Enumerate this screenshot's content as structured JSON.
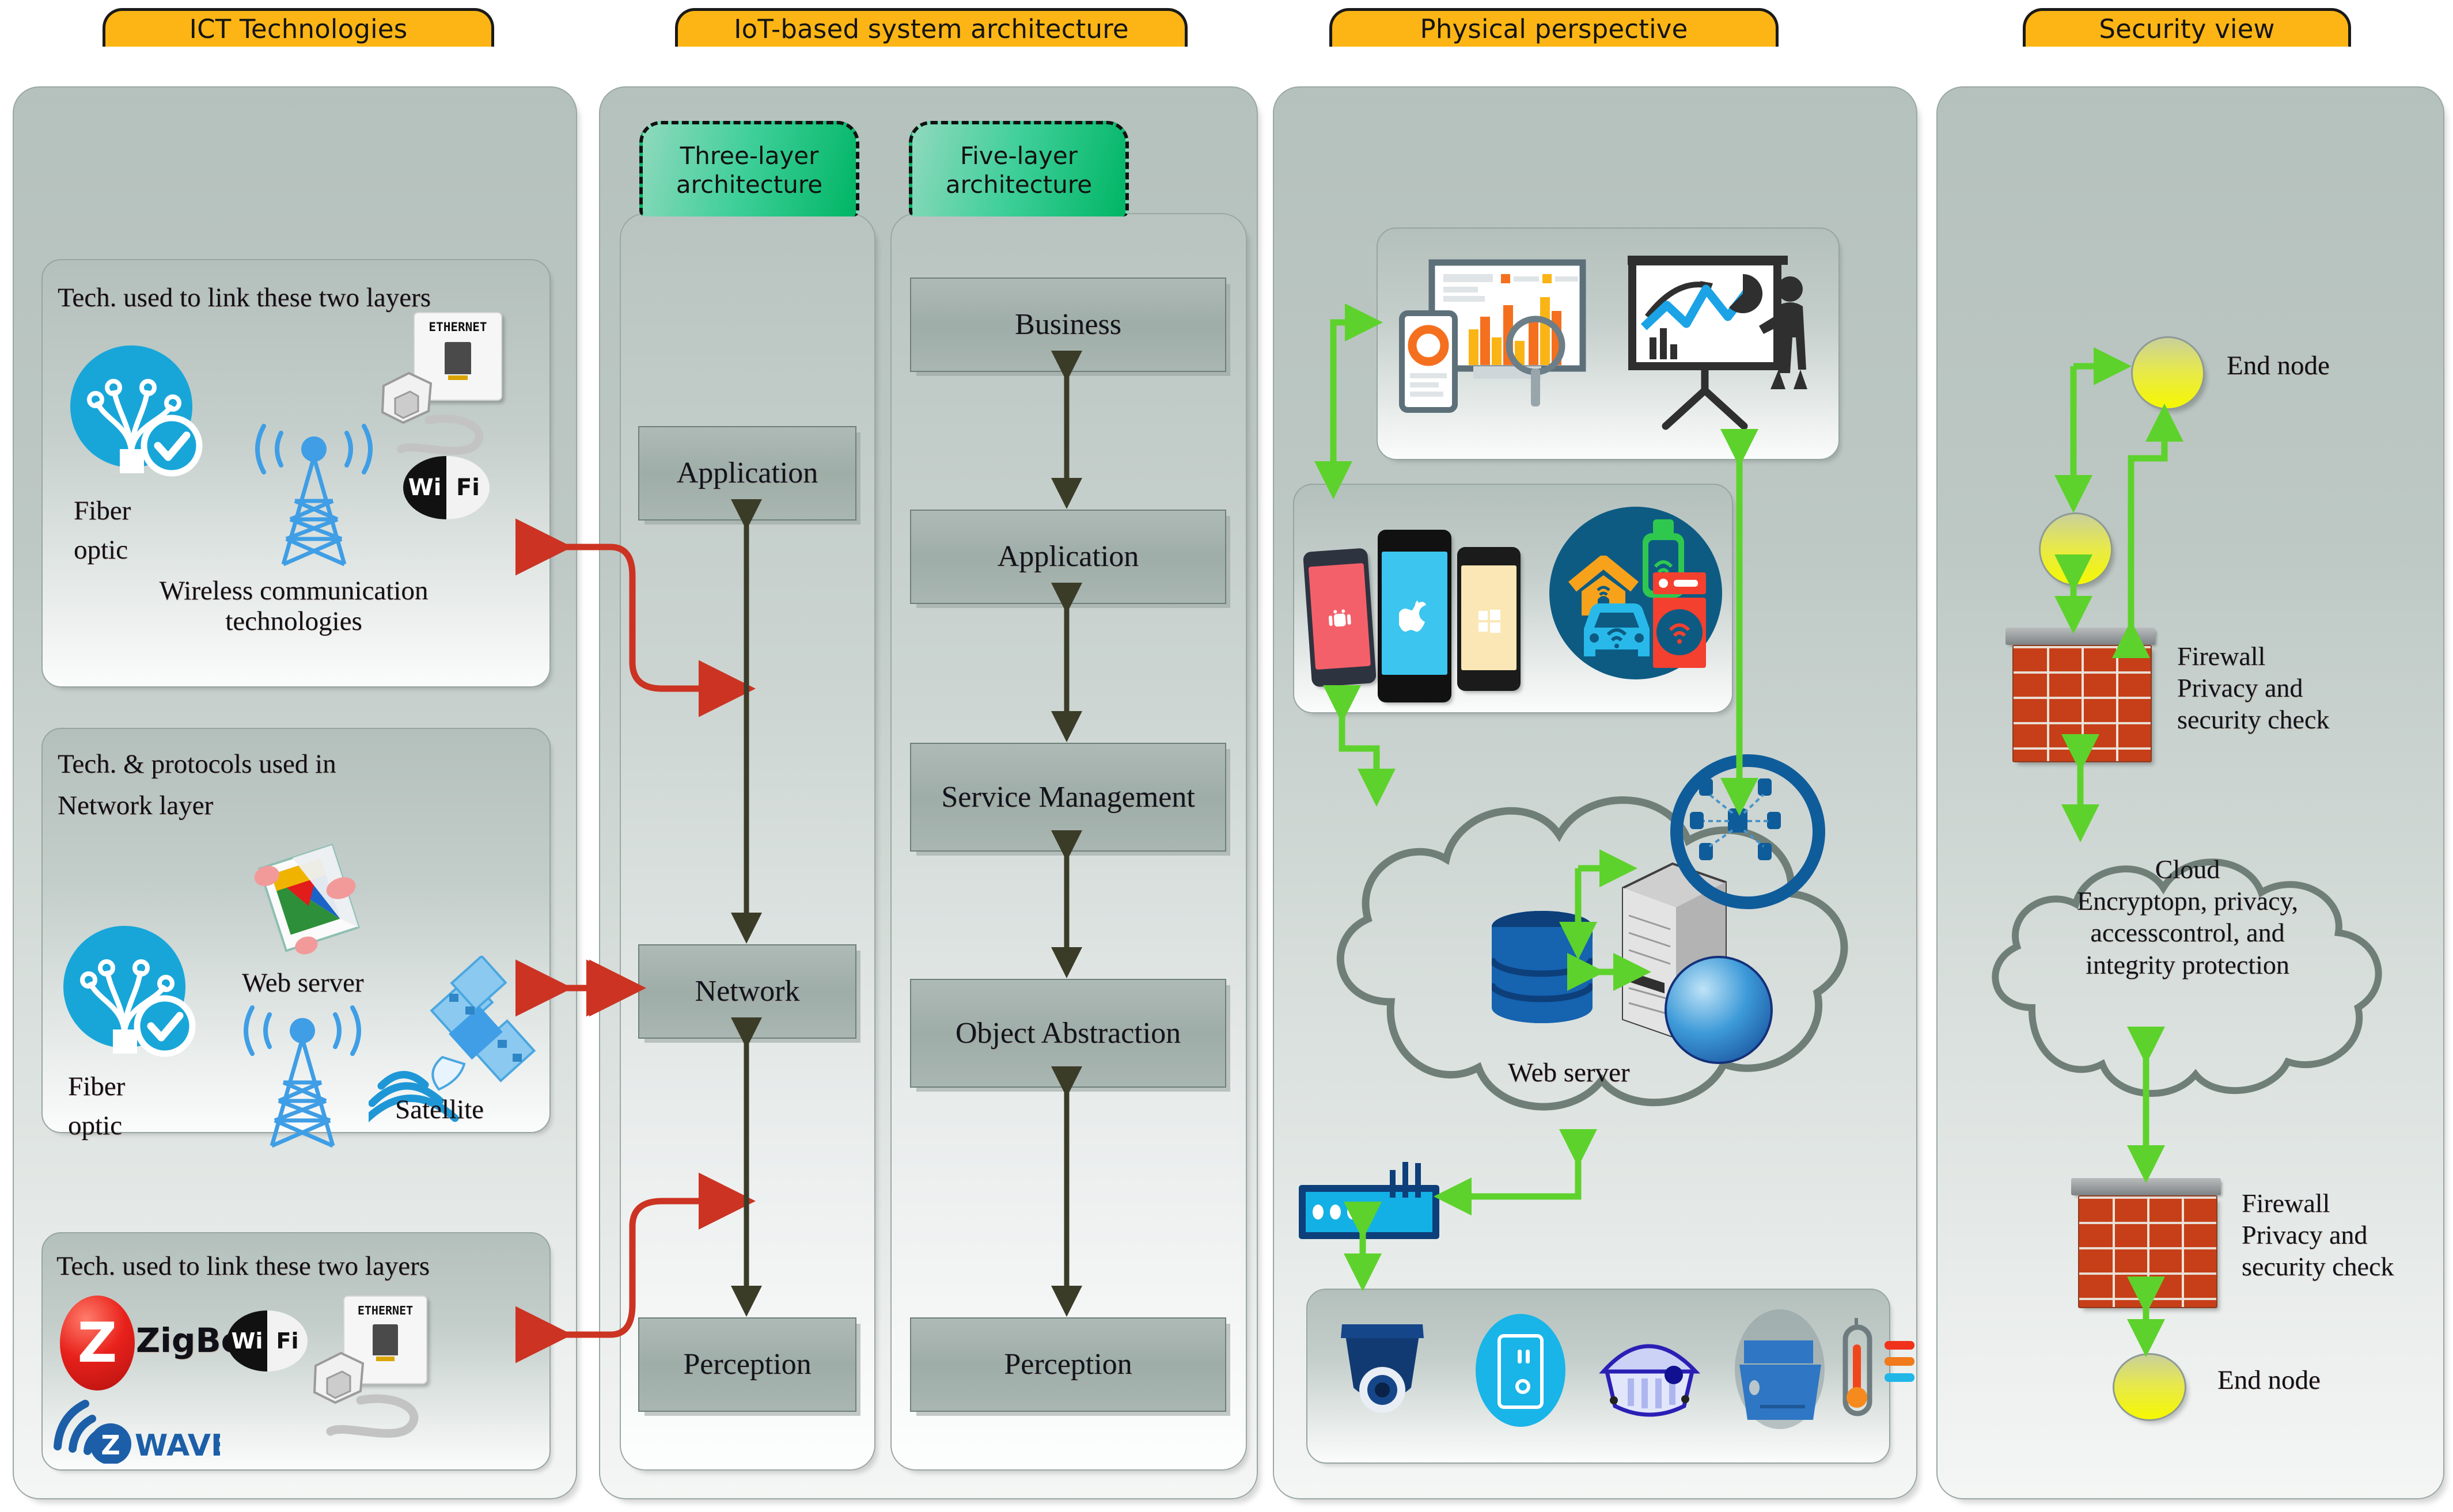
{
  "columns": [
    {
      "id": "ict",
      "tab": "ICT Technologies",
      "groups": [
        {
          "title": "Tech. used to link these two layers",
          "items": [
            "Fiber optic",
            "Wireless communication technologies"
          ],
          "icons": [
            "fiber-optic-icon",
            "radio-tower-icon",
            "ethernet-port-icon",
            "wifi-logo-icon"
          ]
        },
        {
          "title": "Tech. & protocols used in Network layer",
          "items": [
            "Web server",
            "Fiber optic",
            "Satellite"
          ],
          "icons": [
            "web-server-icon",
            "fiber-optic-icon",
            "radio-tower-icon",
            "satellite-icon"
          ]
        },
        {
          "title": "Tech. used to link these two layers",
          "items": [
            "ZigBee",
            "Wi Fi",
            "ETHERNET",
            "Z-WAVE"
          ],
          "icons": [
            "zigbee-logo-icon",
            "wifi-logo-icon",
            "ethernet-port-icon",
            "zwave-logo-icon"
          ]
        }
      ]
    },
    {
      "id": "iot-arch",
      "tab": "IoT-based system architecture",
      "stacks": [
        {
          "cap": "Three-layer architecture",
          "layers": [
            "Application",
            "Network",
            "Perception"
          ]
        },
        {
          "cap": "Five-layer architecture",
          "layers": [
            "Business",
            "Application",
            "Service Management",
            "Object Abstraction",
            "Perception"
          ]
        }
      ]
    },
    {
      "id": "physical",
      "tab": "Physical perspective",
      "labels": [
        "Web server"
      ],
      "icons": [
        "dashboard-analytics-icon",
        "presentation-board-icon",
        "android-phone-icon",
        "apple-phone-icon",
        "windows-phone-icon",
        "smart-home-icon",
        "smart-watch-icon",
        "smart-appliance-icon",
        "connected-car-icon",
        "cloud-shape",
        "database-icon",
        "server-icon",
        "globe-icon",
        "network-nodes-icon",
        "router-icon",
        "cctv-camera-icon",
        "light-switch-icon",
        "smoke-detector-icon",
        "sensor-module-icon",
        "thermometer-icon"
      ]
    },
    {
      "id": "security",
      "tab": "Security view",
      "nodes": [
        {
          "label": "End node",
          "icon": "end-node-icon"
        },
        {
          "label": "Firewall\nPrivacy and\nsecurity check",
          "icon": "firewall-brick-icon"
        },
        {
          "label": "Cloud\nEncryptopn, privacy,\naccesscontrol, and\nintegrity protection",
          "icon": "cloud-shape"
        },
        {
          "label": "Firewall\nPrivacy and\nsecurity check",
          "icon": "firewall-brick-icon"
        },
        {
          "label": "End node",
          "icon": "end-node-icon"
        }
      ],
      "cloud_lines": [
        "Cloud",
        "Encryptopn, privacy,",
        "accesscontrol, and",
        "integrity protection"
      ],
      "firewall_lines": [
        "Firewall",
        "Privacy and",
        "security check"
      ],
      "end_node_label": "End node"
    }
  ],
  "colors": {
    "tab_yellow": "#fcb514",
    "green_cap": "#00b564",
    "panel_gray": "#bdc8c4",
    "red_arrow": "#cc3322",
    "dark_arrow": "#3b3c28",
    "green_arrow": "#5ed22c",
    "brick_red": "#c63f18",
    "end_node_yellow": "#f6f800"
  }
}
